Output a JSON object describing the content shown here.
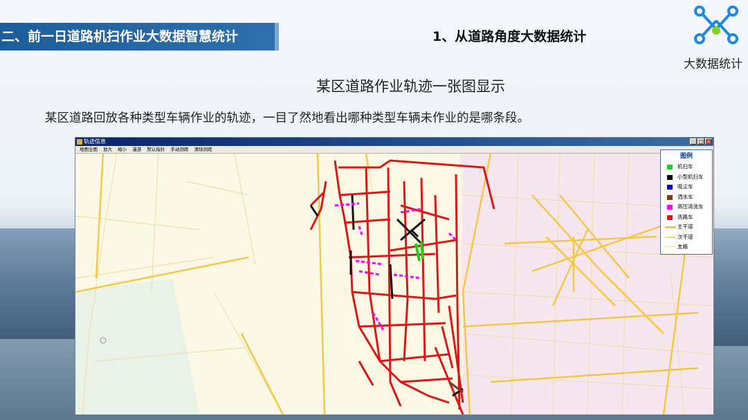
{
  "section_title": "二、前一日道路机扫作业大数据智慧统计",
  "subtitle": "1、从道路角度大数据统计",
  "logo_label": "大数据统计",
  "heading": "某区道路作业轨迹一张图显示",
  "description": "某区道路回放各种类型车辆作业的轨迹，一目了然地看出哪种类型车辆未作业的是哪条段。",
  "window": {
    "title": "轨迹信息",
    "toolbar": [
      "地图全图",
      "放大",
      "缩小",
      "漫游",
      "默认指针",
      "手动测距",
      "清除测距"
    ],
    "buttons": {
      "min": "_",
      "max": "□",
      "close": "×"
    }
  },
  "legend": {
    "title": "图例",
    "items": [
      {
        "label": "机扫车",
        "color": "#1fd11f",
        "kind": "swatch"
      },
      {
        "label": "小型机扫车",
        "color": "#000000",
        "kind": "swatch"
      },
      {
        "label": "吸尘车",
        "color": "#0000cc",
        "kind": "swatch"
      },
      {
        "label": "洒水车",
        "color": "#7a3b1e",
        "kind": "swatch"
      },
      {
        "label": "高压清洗车",
        "color": "#ff00ff",
        "kind": "swatch"
      },
      {
        "label": "洗路车",
        "color": "#ee1111",
        "kind": "swatch"
      },
      {
        "label": "主干道",
        "color": "#f7c640",
        "kind": "line"
      },
      {
        "label": "次干道",
        "color": "#f5d67a",
        "kind": "line"
      },
      {
        "label": "支路",
        "color": "#f3e3b0",
        "kind": "line"
      }
    ]
  }
}
